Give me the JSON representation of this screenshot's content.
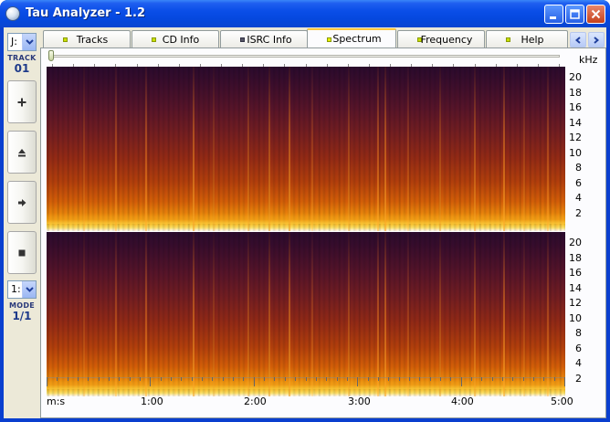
{
  "window": {
    "title": "Tau Analyzer - 1.2",
    "minimize_label": "minimize",
    "maximize_label": "maximize",
    "close_label": "close"
  },
  "left_panel": {
    "drive_value": "J:",
    "track_caption": "TRACK",
    "track_number": "01",
    "mode_value": "1:",
    "mode_caption": "MODE",
    "mode_number": "1/1",
    "buttons": [
      "plus",
      "eject",
      "play",
      "stop"
    ]
  },
  "tabs": [
    {
      "label": "Tracks",
      "led": "lit"
    },
    {
      "label": "CD Info",
      "led": "lit"
    },
    {
      "label": "ISRC Info",
      "led": "dim"
    },
    {
      "label": "Spectrum",
      "led": "lit",
      "active": true
    },
    {
      "label": "Frequency",
      "led": "lit"
    },
    {
      "label": "Help",
      "led": "lit"
    }
  ],
  "spectrum": {
    "unit_label": "kHz",
    "y_ticks": [
      "20",
      "18",
      "16",
      "14",
      "12",
      "10",
      "8",
      "6",
      "4",
      "2"
    ],
    "time_axis_unit": "m:s",
    "time_ticks": [
      "1:00",
      "2:00",
      "3:00",
      "4:00",
      "5:00"
    ],
    "channels": 2
  },
  "colors": {
    "titlebar": "#0a4ee8",
    "window_bg": "#ece9d8",
    "spectrum_low": "#2a0a2e",
    "spectrum_mid": "#922a16",
    "spectrum_high": "#f6b81c",
    "active_tab_highlight": "#ffc83c"
  }
}
